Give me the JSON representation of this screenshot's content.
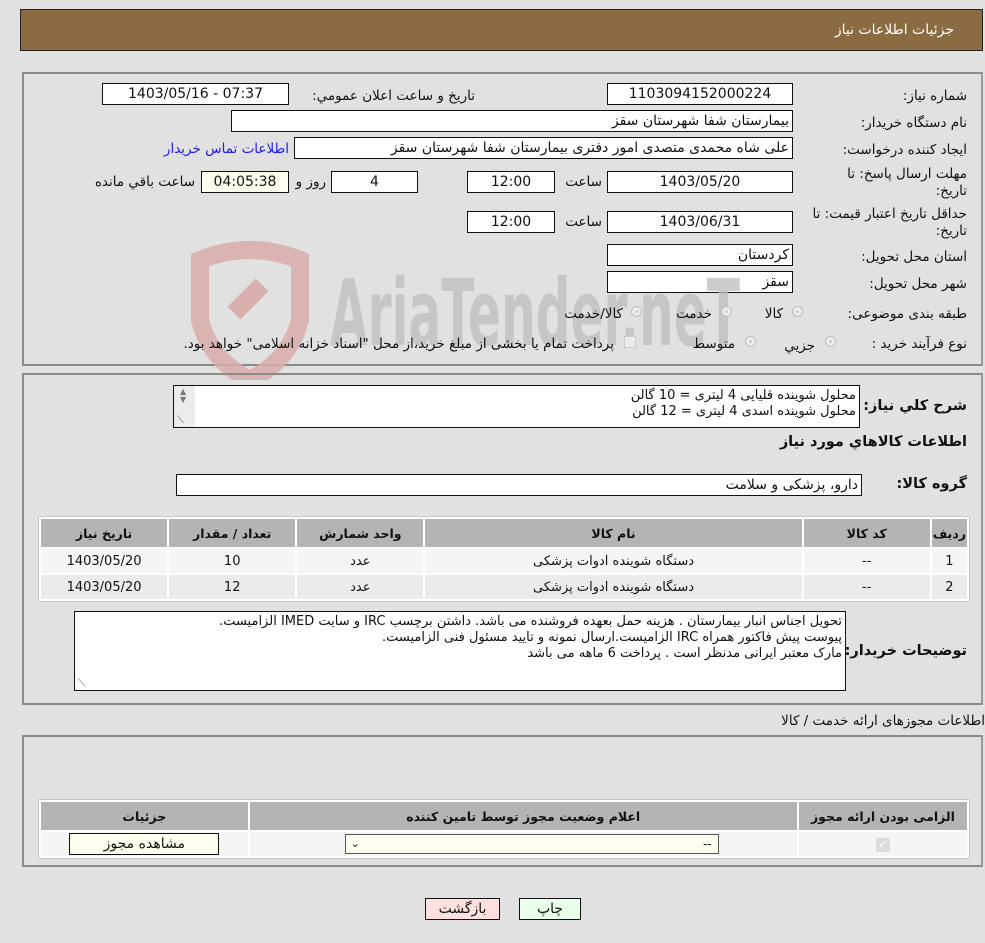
{
  "header": {
    "title": "جزئیات اطلاعات نیاز"
  },
  "details": {
    "need_number_label": "شماره نیاز:",
    "need_number": "1103094152000224",
    "announce_label": "تاریخ و ساعت اعلان عمومي:",
    "announce_value": "1403/05/16 - 07:37",
    "buyer_org_label": "نام دستگاه خریدار:",
    "buyer_org": "بیمارستان شفا شهرستان سقز",
    "creator_label": "ایجاد کننده درخواست:",
    "creator": "علی شاه محمدی متصدی امور دفتری بیمارستان شفا شهرستان سقز",
    "contact_link": "اطلاعات تماس خریدار",
    "deadline_label_1": "مهلت ارسال پاسخ: تا",
    "deadline_label_2": "تاریخ:",
    "deadline_date": "1403/05/20",
    "time_label": "ساعت",
    "deadline_time": "12:00",
    "days_value": "4",
    "days_label": "روز و",
    "remaining_time": "04:05:38",
    "remaining_label": "ساعت باقي مانده",
    "validity_label_1": "حداقل تاریخ اعتبار قیمت: تا",
    "validity_label_2": "تاریخ:",
    "validity_date": "1403/06/31",
    "validity_time": "12:00",
    "province_label": "استان محل تحویل:",
    "province": "کردستان",
    "city_label": "شهر محل تحویل:",
    "city": "سقز",
    "category_label": "طبقه بندی موضوعی:",
    "category_options": [
      "کالا",
      "خدمت",
      "کالا/خدمت"
    ],
    "process_label": "نوع فرآیند خرید :",
    "process_options": [
      "جزيي",
      "متوسط"
    ],
    "process_note": "پرداخت تمام یا بخشی از مبلغ خرید،از محل \"اسناد خزانه اسلامی\" خواهد بود."
  },
  "needs": {
    "summary_label": "شرح كلي نياز:",
    "summary_lines": [
      "محلول شوینده قلیایی 4 لیتری = 10 گالن",
      "محلول شوینده اسدی 4 لیتری = 12 گالن"
    ],
    "goods_info_title": "اطلاعات كالاهاي مورد نياز",
    "goods_group_label": "گروه کالا:",
    "goods_group": "دارو، پزشکی و سلامت",
    "table": {
      "headers": [
        "ردیف",
        "کد کالا",
        "نام کالا",
        "واحد شمارش",
        "تعداد / مقدار",
        "تاریخ نیاز"
      ],
      "rows": [
        [
          "1",
          "--",
          "دستگاه شوینده ادوات پزشکی",
          "عدد",
          "10",
          "1403/05/20"
        ],
        [
          "2",
          "--",
          "دستگاه شوینده ادوات پزشکی",
          "عدد",
          "12",
          "1403/05/20"
        ]
      ]
    },
    "buyer_notes_label": "توضیحات خریدار:",
    "buyer_notes_lines": [
      "تحویل اجناس  انبار بیمارستان . هزینه حمل بعهده فروشنده می باشد.  داشتن برچسب IRC  و سایت  IMED  الزامیست.",
      "پیوست پیش فاکتور همراه IRC  الزامیست.ارسال نمونه و تایید مسئول فنی الزامیست.",
      "مارک معتبر ایرانی مدنظر است . پرداخت 6 ماهه می باشد"
    ]
  },
  "licenses": {
    "section_title": "اطلاعات مجوزهای ارائه خدمت / کالا",
    "headers": [
      "الزامی بودن ارائه مجوز",
      "اعلام وضعیت مجوز توسط تامین کننده",
      "جزئیات"
    ],
    "row": {
      "required_checked": true,
      "status_value": "--",
      "details_button": "مشاهده مجوز"
    }
  },
  "actions": {
    "print": "چاپ",
    "back": "بازگشت"
  },
  "watermark": {
    "text": "AriaTender.neT"
  }
}
